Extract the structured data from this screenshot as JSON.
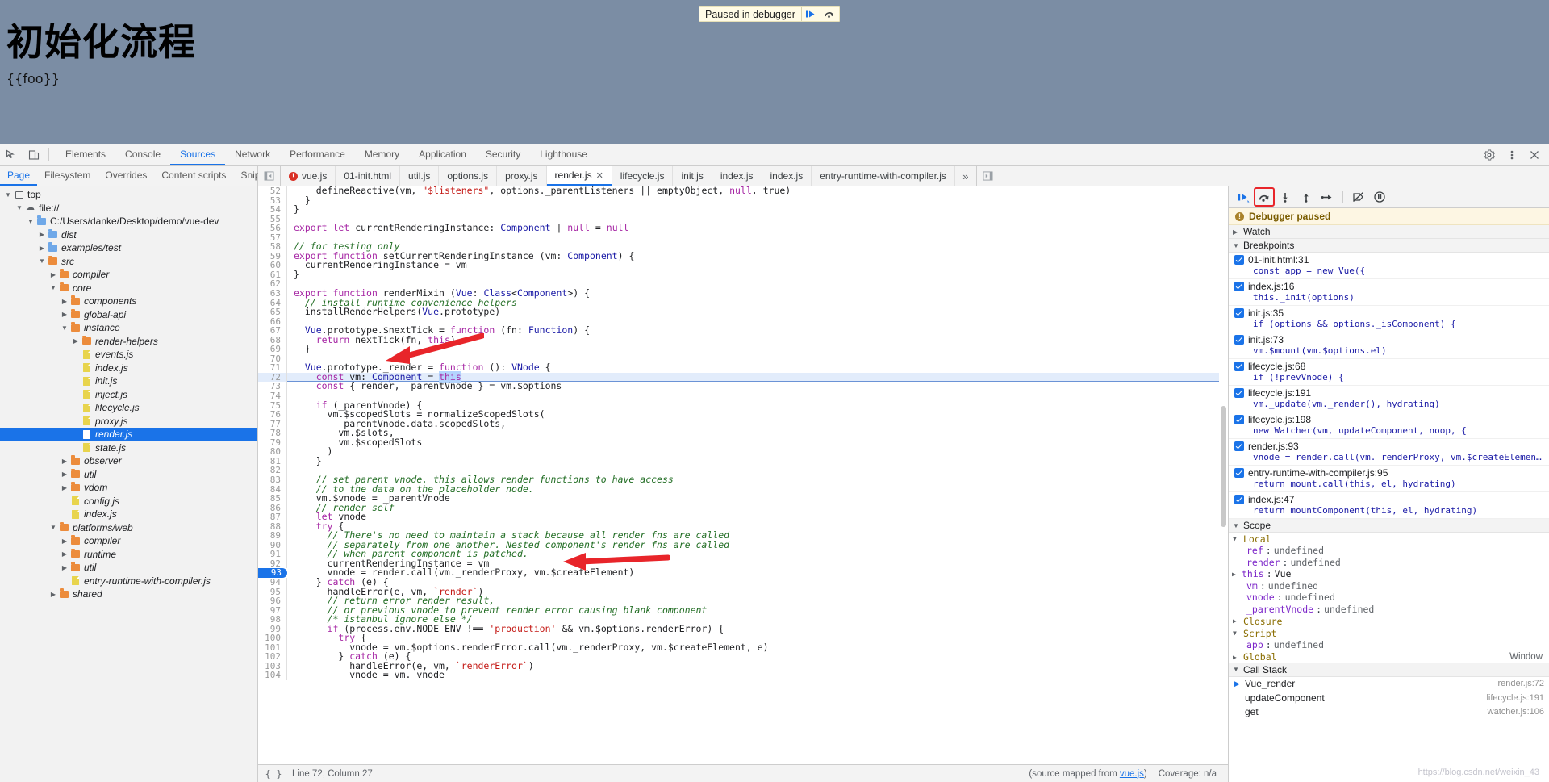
{
  "page": {
    "heading": "初始化流程",
    "interpolation": "{{foo}}",
    "paused_overlay": {
      "label": "Paused in debugger",
      "resume_icon": "resume-icon",
      "step-over_icon": "step-over-icon"
    }
  },
  "toolbar": {
    "inspect_icon": "inspect-element-icon",
    "device_icon": "device-toolbar-icon",
    "panels": [
      {
        "label": "Elements",
        "active": false
      },
      {
        "label": "Console",
        "active": false
      },
      {
        "label": "Sources",
        "active": true
      },
      {
        "label": "Network",
        "active": false
      },
      {
        "label": "Performance",
        "active": false
      },
      {
        "label": "Memory",
        "active": false
      },
      {
        "label": "Application",
        "active": false
      },
      {
        "label": "Security",
        "active": false
      },
      {
        "label": "Lighthouse",
        "active": false
      }
    ],
    "settings_icon": "gear-icon",
    "more_icon": "more-vertical-icon",
    "close_icon": "close-icon"
  },
  "navigator": {
    "tabs": [
      {
        "label": "Page",
        "active": true
      },
      {
        "label": "Filesystem",
        "active": false
      },
      {
        "label": "Overrides",
        "active": false
      },
      {
        "label": "Content scripts",
        "active": false
      },
      {
        "label": "Snippets",
        "active": false
      }
    ],
    "more_icon": "more-vertical-icon",
    "tree": [
      {
        "label": "top",
        "depth": 0,
        "kind": "frame",
        "twisty": "down",
        "selected": false
      },
      {
        "label": "file://",
        "depth": 1,
        "kind": "cloud",
        "twisty": "down",
        "selected": false
      },
      {
        "label": "C:/Users/danke/Desktop/demo/vue-dev",
        "depth": 2,
        "kind": "folder-blue",
        "twisty": "down",
        "selected": false
      },
      {
        "label": "dist",
        "depth": 3,
        "kind": "folder-blue",
        "twisty": "right",
        "selected": false
      },
      {
        "label": "examples/test",
        "depth": 3,
        "kind": "folder-blue",
        "twisty": "right",
        "selected": false
      },
      {
        "label": "src",
        "depth": 3,
        "kind": "folder-orange",
        "twisty": "down",
        "selected": false
      },
      {
        "label": "compiler",
        "depth": 4,
        "kind": "folder-orange",
        "twisty": "right",
        "selected": false
      },
      {
        "label": "core",
        "depth": 4,
        "kind": "folder-orange",
        "twisty": "down",
        "selected": false
      },
      {
        "label": "components",
        "depth": 5,
        "kind": "folder-orange",
        "twisty": "right",
        "selected": false
      },
      {
        "label": "global-api",
        "depth": 5,
        "kind": "folder-orange",
        "twisty": "right",
        "selected": false
      },
      {
        "label": "instance",
        "depth": 5,
        "kind": "folder-orange",
        "twisty": "down",
        "selected": false
      },
      {
        "label": "render-helpers",
        "depth": 6,
        "kind": "folder-orange",
        "twisty": "right",
        "selected": false
      },
      {
        "label": "events.js",
        "depth": 6,
        "kind": "file",
        "twisty": "none",
        "selected": false
      },
      {
        "label": "index.js",
        "depth": 6,
        "kind": "file",
        "twisty": "none",
        "selected": false
      },
      {
        "label": "init.js",
        "depth": 6,
        "kind": "file",
        "twisty": "none",
        "selected": false
      },
      {
        "label": "inject.js",
        "depth": 6,
        "kind": "file",
        "twisty": "none",
        "selected": false
      },
      {
        "label": "lifecycle.js",
        "depth": 6,
        "kind": "file",
        "twisty": "none",
        "selected": false
      },
      {
        "label": "proxy.js",
        "depth": 6,
        "kind": "file",
        "twisty": "none",
        "selected": false
      },
      {
        "label": "render.js",
        "depth": 6,
        "kind": "file-white",
        "twisty": "none",
        "selected": true
      },
      {
        "label": "state.js",
        "depth": 6,
        "kind": "file",
        "twisty": "none",
        "selected": false
      },
      {
        "label": "observer",
        "depth": 5,
        "kind": "folder-orange",
        "twisty": "right",
        "selected": false
      },
      {
        "label": "util",
        "depth": 5,
        "kind": "folder-orange",
        "twisty": "right",
        "selected": false
      },
      {
        "label": "vdom",
        "depth": 5,
        "kind": "folder-orange",
        "twisty": "right",
        "selected": false
      },
      {
        "label": "config.js",
        "depth": 5,
        "kind": "file",
        "twisty": "none",
        "selected": false
      },
      {
        "label": "index.js",
        "depth": 5,
        "kind": "file",
        "twisty": "none",
        "selected": false
      },
      {
        "label": "platforms/web",
        "depth": 4,
        "kind": "folder-orange",
        "twisty": "down",
        "selected": false
      },
      {
        "label": "compiler",
        "depth": 5,
        "kind": "folder-orange",
        "twisty": "right",
        "selected": false
      },
      {
        "label": "runtime",
        "depth": 5,
        "kind": "folder-orange",
        "twisty": "right",
        "selected": false
      },
      {
        "label": "util",
        "depth": 5,
        "kind": "folder-orange",
        "twisty": "right",
        "selected": false
      },
      {
        "label": "entry-runtime-with-compiler.js",
        "depth": 5,
        "kind": "file",
        "twisty": "none",
        "selected": false
      },
      {
        "label": "shared",
        "depth": 4,
        "kind": "folder-orange",
        "twisty": "right",
        "selected": false
      }
    ]
  },
  "file_tabs": {
    "nav_toggle_icon": "show-navigator-icon",
    "more_icon": "more-tabs-icon",
    "panel_toggle_icon": "show-debugger-icon",
    "tabs": [
      {
        "label": "vue.js",
        "active": false,
        "error": true,
        "closable": false
      },
      {
        "label": "01-init.html",
        "active": false,
        "error": false,
        "closable": false
      },
      {
        "label": "util.js",
        "active": false,
        "error": false,
        "closable": false
      },
      {
        "label": "options.js",
        "active": false,
        "error": false,
        "closable": false
      },
      {
        "label": "proxy.js",
        "active": false,
        "error": false,
        "closable": false
      },
      {
        "label": "render.js",
        "active": true,
        "error": false,
        "closable": true
      },
      {
        "label": "lifecycle.js",
        "active": false,
        "error": false,
        "closable": false
      },
      {
        "label": "init.js",
        "active": false,
        "error": false,
        "closable": false
      },
      {
        "label": "index.js",
        "active": false,
        "error": false,
        "closable": false
      },
      {
        "label": "index.js",
        "active": false,
        "error": false,
        "closable": false
      },
      {
        "label": "entry-runtime-with-compiler.js",
        "active": false,
        "error": false,
        "closable": false
      }
    ]
  },
  "editor": {
    "first_line": 52,
    "execution_line": 72,
    "breakpoint_line": 93,
    "lines": [
      {
        "n": 52,
        "text": "    defineReactive(vm, \"$listeners\", options._parentListeners || emptyObject, null, true)"
      },
      {
        "n": 53,
        "text": "  }"
      },
      {
        "n": 54,
        "text": "}"
      },
      {
        "n": 55,
        "text": ""
      },
      {
        "n": 56,
        "text": "export let currentRenderingInstance: Component | null = null"
      },
      {
        "n": 57,
        "text": ""
      },
      {
        "n": 58,
        "text": "// for testing only"
      },
      {
        "n": 59,
        "text": "export function setCurrentRenderingInstance (vm: Component) {"
      },
      {
        "n": 60,
        "text": "  currentRenderingInstance = vm"
      },
      {
        "n": 61,
        "text": "}"
      },
      {
        "n": 62,
        "text": ""
      },
      {
        "n": 63,
        "text": "export function renderMixin (Vue: Class<Component>) {"
      },
      {
        "n": 64,
        "text": "  // install runtime convenience helpers"
      },
      {
        "n": 65,
        "text": "  installRenderHelpers(Vue.prototype)"
      },
      {
        "n": 66,
        "text": ""
      },
      {
        "n": 67,
        "text": "  Vue.prototype.$nextTick = function (fn: Function) {"
      },
      {
        "n": 68,
        "text": "    return nextTick(fn, this)"
      },
      {
        "n": 69,
        "text": "  }"
      },
      {
        "n": 70,
        "text": ""
      },
      {
        "n": 71,
        "text": "  Vue.prototype._render = function (): VNode {"
      },
      {
        "n": 72,
        "text": "    const vm: Component = this"
      },
      {
        "n": 73,
        "text": "    const { render, _parentVnode } = vm.$options"
      },
      {
        "n": 74,
        "text": ""
      },
      {
        "n": 75,
        "text": "    if (_parentVnode) {"
      },
      {
        "n": 76,
        "text": "      vm.$scopedSlots = normalizeScopedSlots("
      },
      {
        "n": 77,
        "text": "        _parentVnode.data.scopedSlots,"
      },
      {
        "n": 78,
        "text": "        vm.$slots,"
      },
      {
        "n": 79,
        "text": "        vm.$scopedSlots"
      },
      {
        "n": 80,
        "text": "      )"
      },
      {
        "n": 81,
        "text": "    }"
      },
      {
        "n": 82,
        "text": ""
      },
      {
        "n": 83,
        "text": "    // set parent vnode. this allows render functions to have access"
      },
      {
        "n": 84,
        "text": "    // to the data on the placeholder node."
      },
      {
        "n": 85,
        "text": "    vm.$vnode = _parentVnode"
      },
      {
        "n": 86,
        "text": "    // render self"
      },
      {
        "n": 87,
        "text": "    let vnode"
      },
      {
        "n": 88,
        "text": "    try {"
      },
      {
        "n": 89,
        "text": "      // There's no need to maintain a stack because all render fns are called"
      },
      {
        "n": 90,
        "text": "      // separately from one another. Nested component's render fns are called"
      },
      {
        "n": 91,
        "text": "      // when parent component is patched."
      },
      {
        "n": 92,
        "text": "      currentRenderingInstance = vm"
      },
      {
        "n": 93,
        "text": "      vnode = render.call(vm._renderProxy, vm.$createElement)"
      },
      {
        "n": 94,
        "text": "    } catch (e) {"
      },
      {
        "n": 95,
        "text": "      handleError(e, vm, `render`)"
      },
      {
        "n": 96,
        "text": "      // return error render result,"
      },
      {
        "n": 97,
        "text": "      // or previous vnode to prevent render error causing blank component"
      },
      {
        "n": 98,
        "text": "      /* istanbul ignore else */"
      },
      {
        "n": 99,
        "text": "      if (process.env.NODE_ENV !== 'production' && vm.$options.renderError) {"
      },
      {
        "n": 100,
        "text": "        try {"
      },
      {
        "n": 101,
        "text": "          vnode = vm.$options.renderError.call(vm._renderProxy, vm.$createElement, e)"
      },
      {
        "n": 102,
        "text": "        } catch (e) {"
      },
      {
        "n": 103,
        "text": "          handleError(e, vm, `renderError`)"
      },
      {
        "n": 104,
        "text": "          vnode = vm._vnode"
      }
    ]
  },
  "status_bar": {
    "format_icon": "pretty-print-icon",
    "cursor": "Line 72, Column 27",
    "source_mapped_prefix": "(source mapped from ",
    "source_mapped_link": "vue.js",
    "source_mapped_suffix": ")",
    "coverage": "Coverage: n/a"
  },
  "debugger": {
    "toolbar": {
      "resume_label": "resume-script-execution",
      "step_over_label": "step-over-next-function-call",
      "step_into_label": "step-into-next-function-call",
      "step_out_label": "step-out-of-current-function",
      "step_label": "step",
      "deactivate_label": "deactivate-breakpoints",
      "pause_on_exceptions_label": "pause-on-exceptions",
      "highlighted_button": "step-over-next-function-call"
    },
    "paused_banner": "Debugger paused",
    "sections": {
      "watch": {
        "label": "Watch",
        "expanded": false
      },
      "breakpoints": {
        "label": "Breakpoints",
        "expanded": true
      },
      "scope": {
        "label": "Scope",
        "expanded": true
      },
      "call_stack": {
        "label": "Call Stack",
        "expanded": true
      }
    },
    "breakpoints": [
      {
        "checked": true,
        "location": "01-init.html:31",
        "code": "const app = new Vue({"
      },
      {
        "checked": true,
        "location": "index.js:16",
        "code": "this._init(options)"
      },
      {
        "checked": true,
        "location": "init.js:35",
        "code": "if (options && options._isComponent) {"
      },
      {
        "checked": true,
        "location": "init.js:73",
        "code": "vm.$mount(vm.$options.el)"
      },
      {
        "checked": true,
        "location": "lifecycle.js:68",
        "code": "if (!prevVnode) {"
      },
      {
        "checked": true,
        "location": "lifecycle.js:191",
        "code": "vm._update(vm._render(), hydrating)"
      },
      {
        "checked": true,
        "location": "lifecycle.js:198",
        "code": "new Watcher(vm, updateComponent, noop, {"
      },
      {
        "checked": true,
        "location": "render.js:93",
        "code": "vnode = render.call(vm._renderProxy, vm.$createElement)"
      },
      {
        "checked": true,
        "location": "entry-runtime-with-compiler.js:95",
        "code": "return mount.call(this, el, hydrating)"
      },
      {
        "checked": true,
        "location": "index.js:47",
        "code": "return mountComponent(this, el, hydrating)"
      }
    ],
    "scope": {
      "local_label": "Local",
      "local_vars": [
        {
          "name": "ref",
          "value": "undefined",
          "expandable": false
        },
        {
          "name": "render",
          "value": "undefined",
          "expandable": false
        },
        {
          "name": "this",
          "value": "Vue",
          "expandable": true
        },
        {
          "name": "vm",
          "value": "undefined",
          "expandable": false
        },
        {
          "name": "vnode",
          "value": "undefined",
          "expandable": false
        },
        {
          "name": "_parentVnode",
          "value": "undefined",
          "expandable": false
        }
      ],
      "closure_label": "Closure",
      "script_label": "Script",
      "script_vars": [
        {
          "name": "app",
          "value": "undefined",
          "expandable": false
        }
      ],
      "global_label": "Global",
      "global_value": "Window"
    },
    "call_stack": [
      {
        "name": "Vue_render",
        "location": "render.js:72",
        "current": true
      },
      {
        "name": "updateComponent",
        "location": "lifecycle.js:191",
        "current": false
      },
      {
        "name": "get",
        "location": "watcher.js:106",
        "current": false
      }
    ]
  },
  "watermark": "https://blog.csdn.net/weixin_43",
  "colors": {
    "accent": "#1a73e8",
    "error": "#d93025",
    "paused_bg": "#fdf6e3",
    "highlight_box": "#e8252a",
    "page_overlay": "#7b8da4"
  }
}
